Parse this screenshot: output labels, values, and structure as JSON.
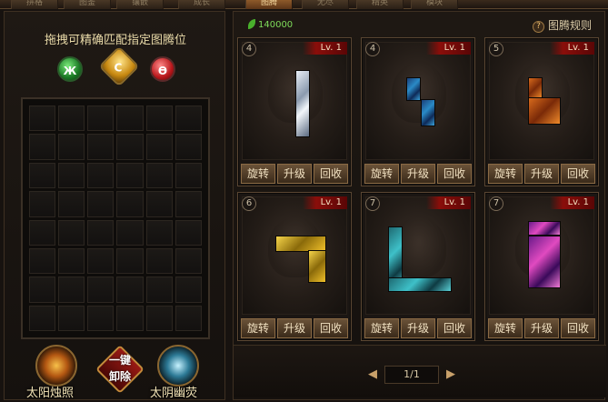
{
  "tabs": [
    {
      "label": "拼格",
      "active": false
    },
    {
      "label": "图鉴",
      "active": false
    },
    {
      "label": "镶嵌",
      "active": false
    },
    {
      "label": "成长",
      "active": false
    },
    {
      "label": "图腾",
      "active": true
    },
    {
      "label": "无尽",
      "active": false
    },
    {
      "label": "精英",
      "active": false
    },
    {
      "label": "模块",
      "active": false
    }
  ],
  "left": {
    "title": "拖拽可精确匹配指定图腾位",
    "gems": [
      "Ж",
      "C",
      "Ѳ"
    ],
    "sun_label": "太阳烛照",
    "remove_label_1": "一键",
    "remove_label_2": "卸除",
    "moon_label": "太阴幽荧"
  },
  "right": {
    "resource": "140000",
    "rules": "图腾规则",
    "cards": [
      {
        "num": "4",
        "lv": "Lv. 1",
        "rotate": "旋转",
        "upgrade": "升级",
        "recycle": "回收",
        "color": "silver"
      },
      {
        "num": "4",
        "lv": "Lv. 1",
        "rotate": "旋转",
        "upgrade": "升级",
        "recycle": "回收",
        "color": "blue"
      },
      {
        "num": "5",
        "lv": "Lv. 1",
        "rotate": "旋转",
        "upgrade": "升级",
        "recycle": "回收",
        "color": "orange"
      },
      {
        "num": "6",
        "lv": "Lv. 1",
        "rotate": "旋转",
        "upgrade": "升级",
        "recycle": "回收",
        "color": "gold"
      },
      {
        "num": "7",
        "lv": "Lv. 1",
        "rotate": "旋转",
        "upgrade": "升级",
        "recycle": "回收",
        "color": "teal"
      },
      {
        "num": "7",
        "lv": "Lv. 1",
        "rotate": "旋转",
        "upgrade": "升级",
        "recycle": "回收",
        "color": "purple"
      }
    ],
    "page": "1/1"
  }
}
